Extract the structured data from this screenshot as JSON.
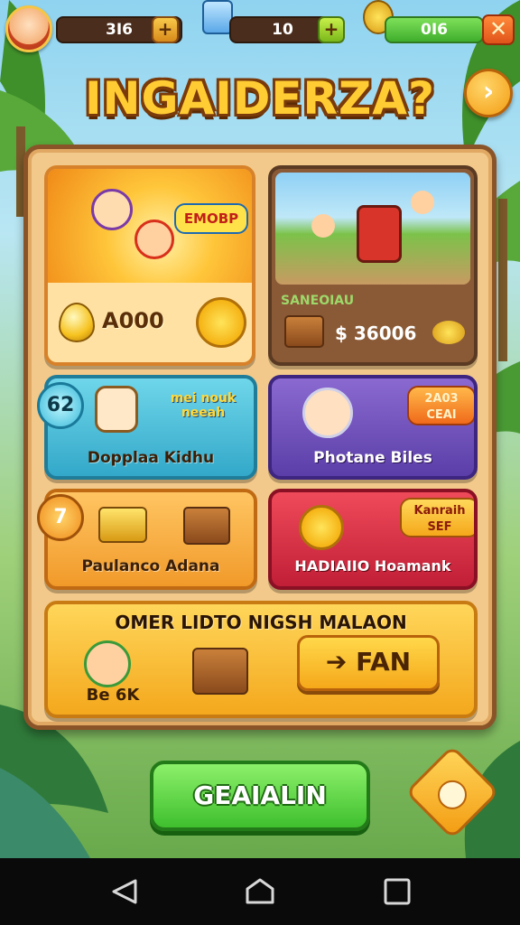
{
  "hud": {
    "coins": "3I6",
    "cards": "10",
    "money": "0I6",
    "coins_plus": "+",
    "close": "✕",
    "add_icon": "plus-icon"
  },
  "title": "INGAIDERZA?",
  "next_arrow": "›",
  "tiles": {
    "reward": {
      "badge": "EMOBP",
      "amount": "A000"
    },
    "shop": {
      "label": "SANEOIAU",
      "price": "$ 36006"
    },
    "blue": {
      "sign": "mei nouk neeah",
      "label": "Dopplaa Kidhu",
      "badge": "62"
    },
    "purple": {
      "badge": "2A03 CEAI",
      "label": "Photane Biles"
    },
    "orange": {
      "badge": "7",
      "label": "Paulanco Adana"
    },
    "red": {
      "badge": "Kanraih SEF",
      "label": "HADIAIIO Hoamank"
    },
    "wide": {
      "title": "OMER LIDTO NIGSH MALAON",
      "tag": "Be 6K",
      "play_label": "FAN",
      "play_arrow": "➔"
    }
  },
  "main_button": "GEAIALIN",
  "colors": {
    "gold": "#ffcc33",
    "green": "#3fbf2e",
    "wood": "#8a5428"
  }
}
